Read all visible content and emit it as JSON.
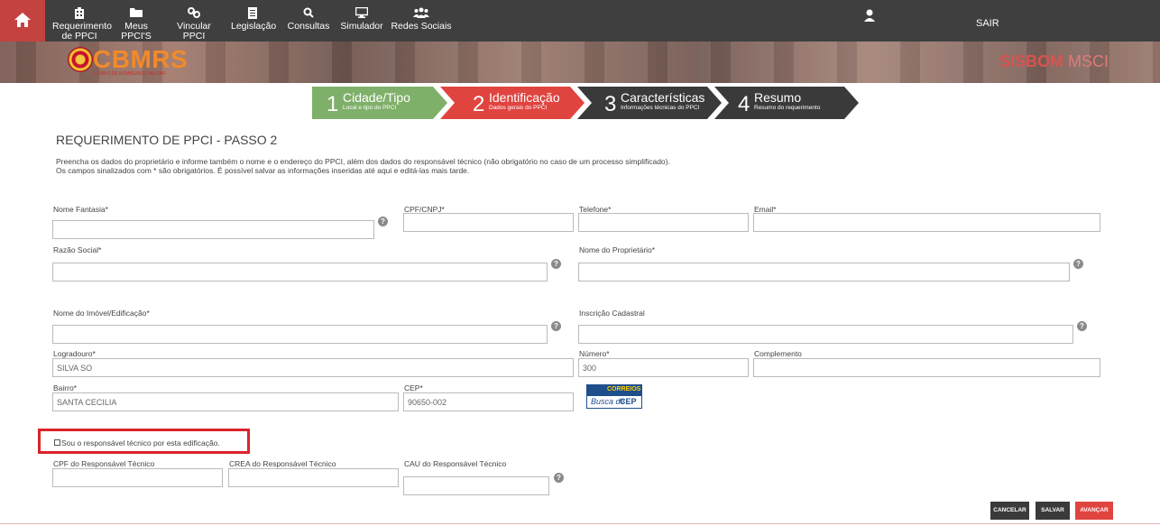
{
  "nav": {
    "items": [
      {
        "label": "Requerimento\nde PPCI",
        "icon": "building-icon"
      },
      {
        "label": "Meus PPCI'S",
        "icon": "folder-icon"
      },
      {
        "label": "Vincular PPCI",
        "icon": "link-icon"
      },
      {
        "label": "Legislação",
        "icon": "document-icon"
      },
      {
        "label": "Consultas",
        "icon": "search-icon"
      },
      {
        "label": "Simulador",
        "icon": "monitor-icon"
      },
      {
        "label": "Redes Sociais",
        "icon": "users-icon"
      }
    ],
    "logout": "SAIR"
  },
  "banner": {
    "logo_text": "CBMRS",
    "logo_sub": "CORPO DE BOMBEIROS MILITAR",
    "brand_left": "SISBOM",
    "brand_right": " MSCI"
  },
  "steps": [
    {
      "num": "1",
      "title": "Cidade/Tipo",
      "sub": "Local e tipo do PPCI",
      "color": "#7fb06a"
    },
    {
      "num": "2",
      "title": "Identificação",
      "sub": "Dados gerais do PPCI",
      "color": "#e0443f"
    },
    {
      "num": "3",
      "title": "Características",
      "sub": "Informações técnicas do PPCI",
      "color": "#3a3a3a"
    },
    {
      "num": "4",
      "title": "Resumo",
      "sub": "Resumo do requerimento",
      "color": "#3a3a3a"
    }
  ],
  "page": {
    "title": "REQUERIMENTO DE PPCI - PASSO 2",
    "intro_1": "Preencha os dados do proprietário e informe também o nome e o endereço do PPCI, além dos dados do responsável técnico (não obrigatório no caso de um processo simplificado).",
    "intro_2": "Os campos sinalizados com * são obrigatórios. É possível salvar as informações inseridas até aqui e editá-las mais tarde."
  },
  "form": {
    "nome_fantasia": {
      "label": "Nome Fantasia*",
      "value": ""
    },
    "cpf_cnpj": {
      "label": "CPF/CNPJ*",
      "value": ""
    },
    "telefone": {
      "label": "Telefone*",
      "value": ""
    },
    "email": {
      "label": "Email*",
      "value": ""
    },
    "razao_social": {
      "label": "Razão Social*",
      "value": ""
    },
    "nome_proprietario": {
      "label": "Nome do Proprietário*",
      "value": ""
    },
    "nome_imovel": {
      "label": "Nome do Imóvel/Edificação*",
      "value": ""
    },
    "inscricao": {
      "label": "Inscrição Cadastral",
      "value": ""
    },
    "logradouro": {
      "label": "Logradouro*",
      "value": "SILVA SO"
    },
    "numero": {
      "label": "Número*",
      "value": "300"
    },
    "complemento": {
      "label": "Complemento",
      "value": ""
    },
    "bairro": {
      "label": "Bairro*",
      "value": "SANTA CECILIA"
    },
    "cep": {
      "label": "CEP*",
      "value": "90650-002"
    },
    "correios": {
      "top": "CORREIOS",
      "left": "Busca de",
      "right": "CEP"
    },
    "responsavel": {
      "label": "Sou o responsável técnico por esta edificação.",
      "checked": false
    },
    "cpf_resp": {
      "label": "CPF do Responsável Técnico",
      "value": ""
    },
    "crea_resp": {
      "label": "CREA do Responsável Técnico",
      "value": ""
    },
    "cau_resp": {
      "label": "CAU do Responsável Técnico",
      "value": ""
    },
    "help_glyph": "?"
  },
  "buttons": {
    "cancel": "CANCELAR",
    "save": "SALVAR",
    "next": "AVANÇAR"
  },
  "colors": {
    "accent": "#d9534f",
    "nav_bg": "#3f3f3f",
    "step_done": "#7fb06a",
    "step_active": "#e0443f",
    "step_todo": "#3a3a3a"
  }
}
